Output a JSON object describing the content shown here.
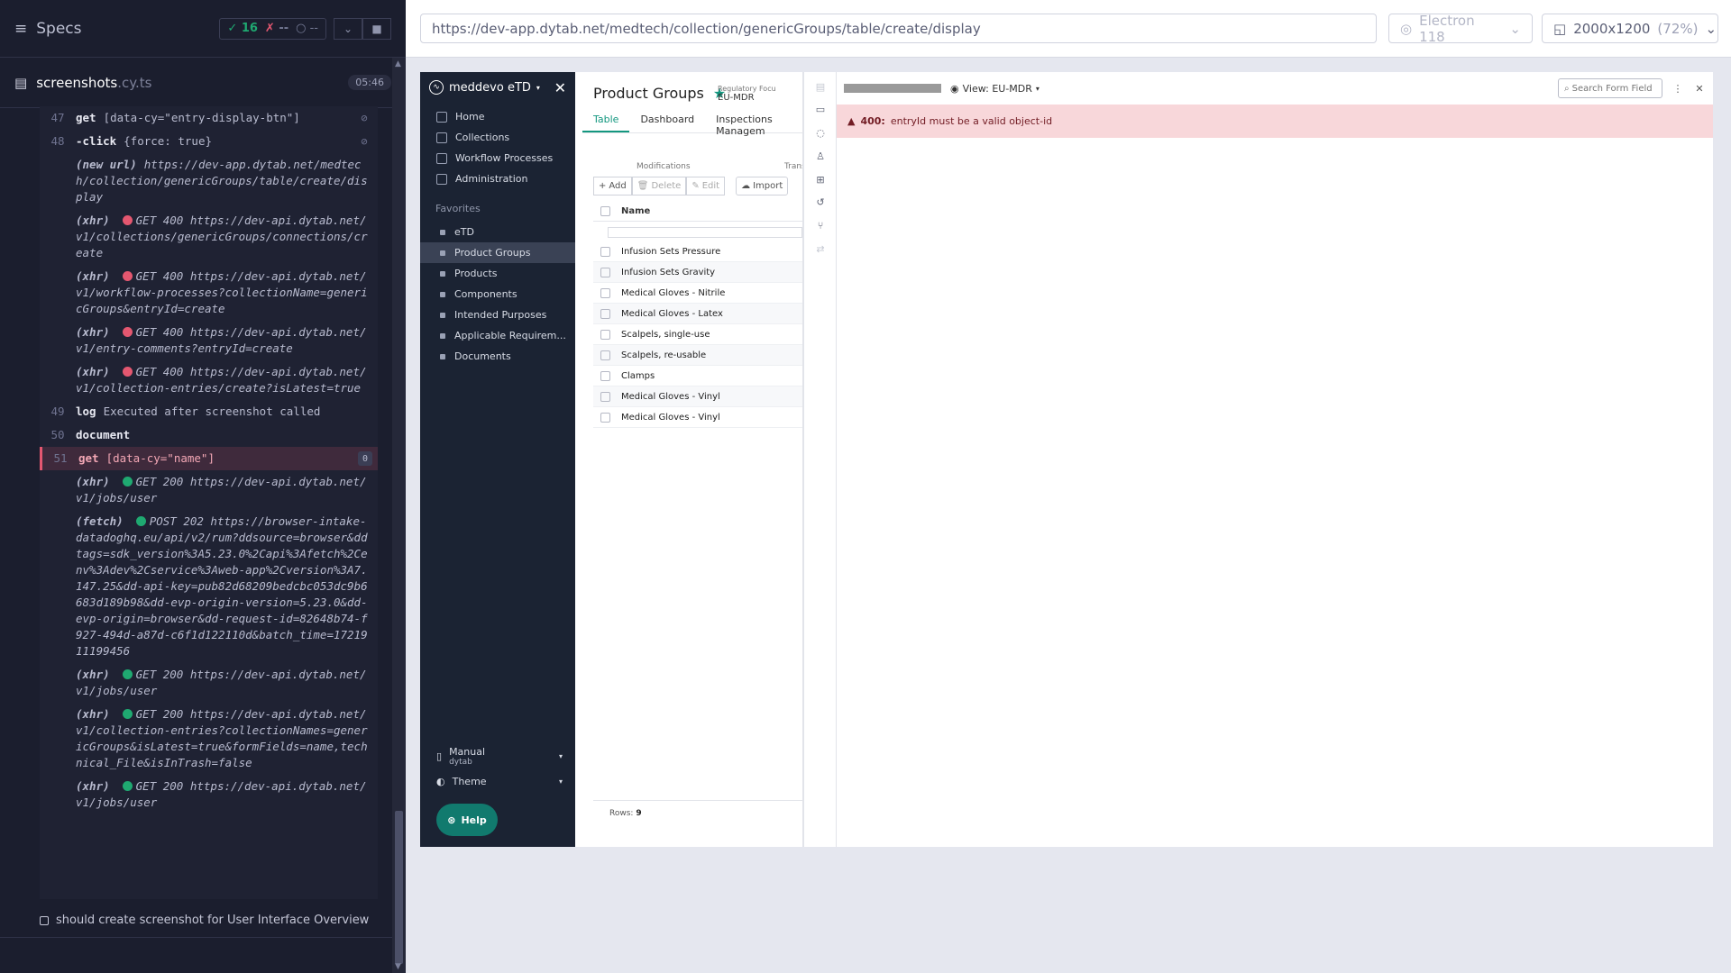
{
  "reporter": {
    "specs_label": "Specs",
    "stats": {
      "passed": "16",
      "failed": "--",
      "pending": "--"
    },
    "file": {
      "name": "screenshots",
      "ext": ".cy.ts",
      "time": "05:46"
    },
    "commands": [
      {
        "num": "47",
        "method": "get",
        "msg": "[data-cy=\"entry-display-btn\"]",
        "eye": true
      },
      {
        "num": "48",
        "method": "-click",
        "msg": "{force: true}",
        "eye": true
      },
      {
        "num": "",
        "method": "(new url)",
        "msg": "https://dev-app.dytab.net/medtech/collection/genericGroups/table/create/display",
        "italic": true
      },
      {
        "num": "",
        "method": "(xhr)",
        "status": "red",
        "msg": "GET 400 https://dev-api.dytab.net/v1/collections/genericGroups/connections/create",
        "italic": true
      },
      {
        "num": "",
        "method": "(xhr)",
        "status": "red",
        "msg": "GET 400 https://dev-api.dytab.net/v1/workflow-processes?collectionName=genericGroups&entryId=create",
        "italic": true
      },
      {
        "num": "",
        "method": "(xhr)",
        "status": "red",
        "msg": "GET 400 https://dev-api.dytab.net/v1/entry-comments?entryId=create",
        "italic": true
      },
      {
        "num": "",
        "method": "(xhr)",
        "status": "red",
        "msg": "GET 400 https://dev-api.dytab.net/v1/collection-entries/create?isLatest=true",
        "italic": true
      },
      {
        "num": "49",
        "method": "log",
        "msg": "Executed after screenshot called"
      },
      {
        "num": "50",
        "method": "document",
        "msg": ""
      },
      {
        "num": "51",
        "method": "get",
        "msg": "[data-cy=\"name\"]",
        "active": true,
        "badge": "0"
      },
      {
        "num": "",
        "method": "(xhr)",
        "status": "green",
        "msg": "GET 200 https://dev-api.dytab.net/v1/jobs/user",
        "italic": true
      },
      {
        "num": "",
        "method": "(fetch)",
        "status": "green",
        "msg": "POST 202 https://browser-intake-datadoghq.eu/api/v2/rum?ddsource=browser&ddtags=sdk_version%3A5.23.0%2Capi%3Afetch%2Cenv%3Adev%2Cservice%3Aweb-app%2Cversion%3A7.147.25&dd-api-key=pub82d68209bedcbc053dc9b6683d189b98&dd-evp-origin-version=5.23.0&dd-evp-origin=browser&dd-request-id=82648b74-f927-494d-a87d-c6f1d122110d&batch_time=1721911199456",
        "italic": true
      },
      {
        "num": "",
        "method": "(xhr)",
        "status": "green",
        "msg": "GET 200 https://dev-api.dytab.net/v1/jobs/user",
        "italic": true
      },
      {
        "num": "",
        "method": "(xhr)",
        "status": "green",
        "msg": "GET 200 https://dev-api.dytab.net/v1/collection-entries?collectionNames=genericGroups&isLatest=true&formFields=name,technical_File&isInTrash=false",
        "italic": true
      },
      {
        "num": "",
        "method": "(xhr)",
        "status": "green",
        "msg": "GET 200 https://dev-api.dytab.net/v1/jobs/user",
        "italic": true
      }
    ],
    "test_title": "should create screenshot for User Interface Overview"
  },
  "browser": {
    "url": "https://dev-app.dytab.net/medtech/collection/genericGroups/table/create/display",
    "browser_name": "Electron 118",
    "viewport": "2000x1200",
    "zoom": "(72%)"
  },
  "app": {
    "brand": "meddevo eTD",
    "nav": [
      "Home",
      "Collections",
      "Workflow Processes",
      "Administration"
    ],
    "favorites_label": "Favorites",
    "favorites": [
      "eTD",
      "Product Groups",
      "Products",
      "Components",
      "Intended Purposes",
      "Applicable Requirem...",
      "Documents"
    ],
    "selected_favorite": "Product Groups",
    "manual_label": "Manual",
    "manual_sub": "dytab",
    "theme_label": "Theme",
    "help_label": "Help",
    "page_title": "Product Groups",
    "reg_label": "Regulatory Focu",
    "reg_value": "EU-MDR",
    "tabs": [
      "Table",
      "Dashboard",
      "Inspections Managem"
    ],
    "modifications_label": "Modifications",
    "transfer_label": "Transf",
    "toolbar": {
      "add": "Add",
      "delete": "Delete",
      "edit": "Edit",
      "import": "Import"
    },
    "column_name": "Name",
    "rows": [
      "Infusion Sets Pressure",
      "Infusion Sets Gravity",
      "Medical Gloves - Nitrile",
      "Medical Gloves - Latex",
      "Scalpels, single-use",
      "Scalpels, re-usable",
      "Clamps",
      "Medical Gloves - Vinyl",
      "Medical Gloves - Vinyl"
    ],
    "rows_label": "Rows:",
    "rows_count": "9",
    "detail": {
      "view_label": "View: EU-MDR",
      "search_placeholder": "Search Form Field",
      "error_code": "400:",
      "error_msg": "entryId must be a valid object-id"
    }
  },
  "colors": {
    "accent": "#13977f",
    "error_bg": "#f8d7da",
    "sidebar": "#1b2333",
    "reporter": "#1b1e2e"
  }
}
